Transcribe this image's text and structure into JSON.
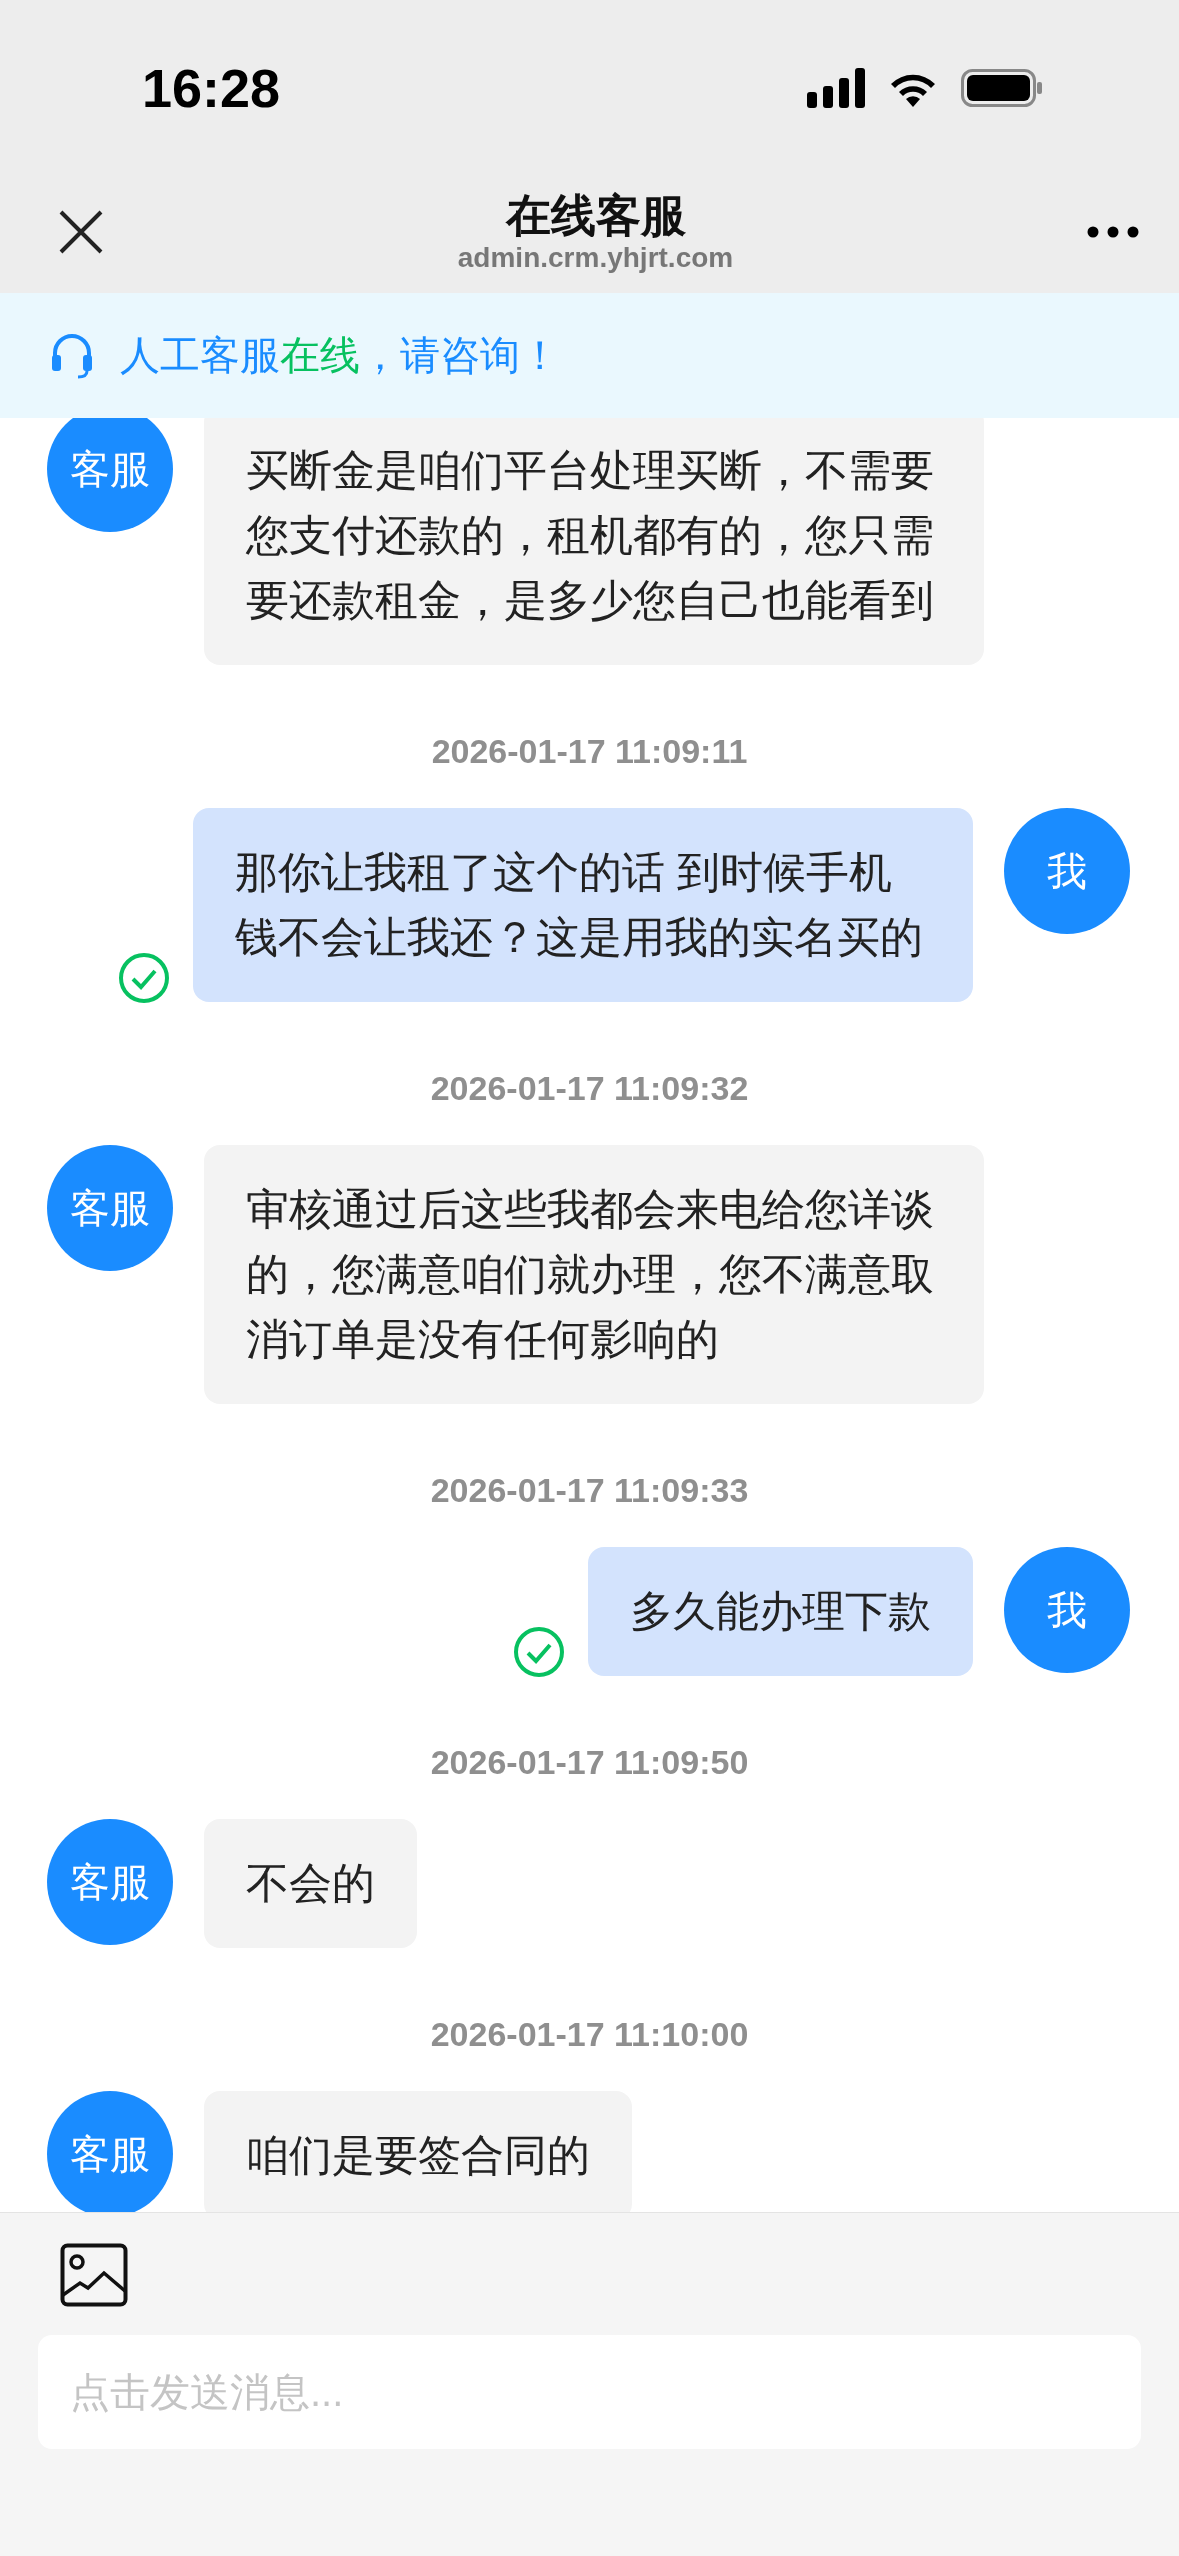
{
  "status_bar": {
    "time": "16:28"
  },
  "nav": {
    "title": "在线客服",
    "subtitle": "admin.crm.yhjrt.com"
  },
  "notice": {
    "parts": [
      {
        "text": "人工客服",
        "color": "#1a8cff"
      },
      {
        "text": "在线",
        "color": "#07c160"
      },
      {
        "text": "，请咨询！",
        "color": "#1a8cff"
      }
    ]
  },
  "messages": [
    {
      "kind": "message",
      "outgoing": false,
      "avatar": "客服",
      "text": "买断金是咱们平台处理买断，不需要您支付还款的，租机都有的，您只需要还款租金，是多少您自己也能看到"
    },
    {
      "kind": "timestamp",
      "text": "2026-01-17 11:09:11"
    },
    {
      "kind": "message",
      "outgoing": true,
      "avatar": "我",
      "text": "那你让我租了这个的话 到时候手机钱不会让我还？这是用我的实名买的",
      "read": true
    },
    {
      "kind": "timestamp",
      "text": "2026-01-17 11:09:32"
    },
    {
      "kind": "message",
      "outgoing": false,
      "avatar": "客服",
      "text": "审核通过后这些我都会来电给您详谈的，您满意咱们就办理，您不满意取消订单是没有任何影响的"
    },
    {
      "kind": "timestamp",
      "text": "2026-01-17 11:09:33"
    },
    {
      "kind": "message",
      "outgoing": true,
      "avatar": "我",
      "text": "多久能办理下款",
      "read": true
    },
    {
      "kind": "timestamp",
      "text": "2026-01-17 11:09:50"
    },
    {
      "kind": "message",
      "outgoing": false,
      "avatar": "客服",
      "text": "不会的"
    },
    {
      "kind": "timestamp",
      "text": "2026-01-17 11:10:00"
    },
    {
      "kind": "message",
      "outgoing": false,
      "avatar": "客服",
      "text": "咱们是要签合同的"
    }
  ],
  "composer": {
    "placeholder": "点击发送消息..."
  }
}
